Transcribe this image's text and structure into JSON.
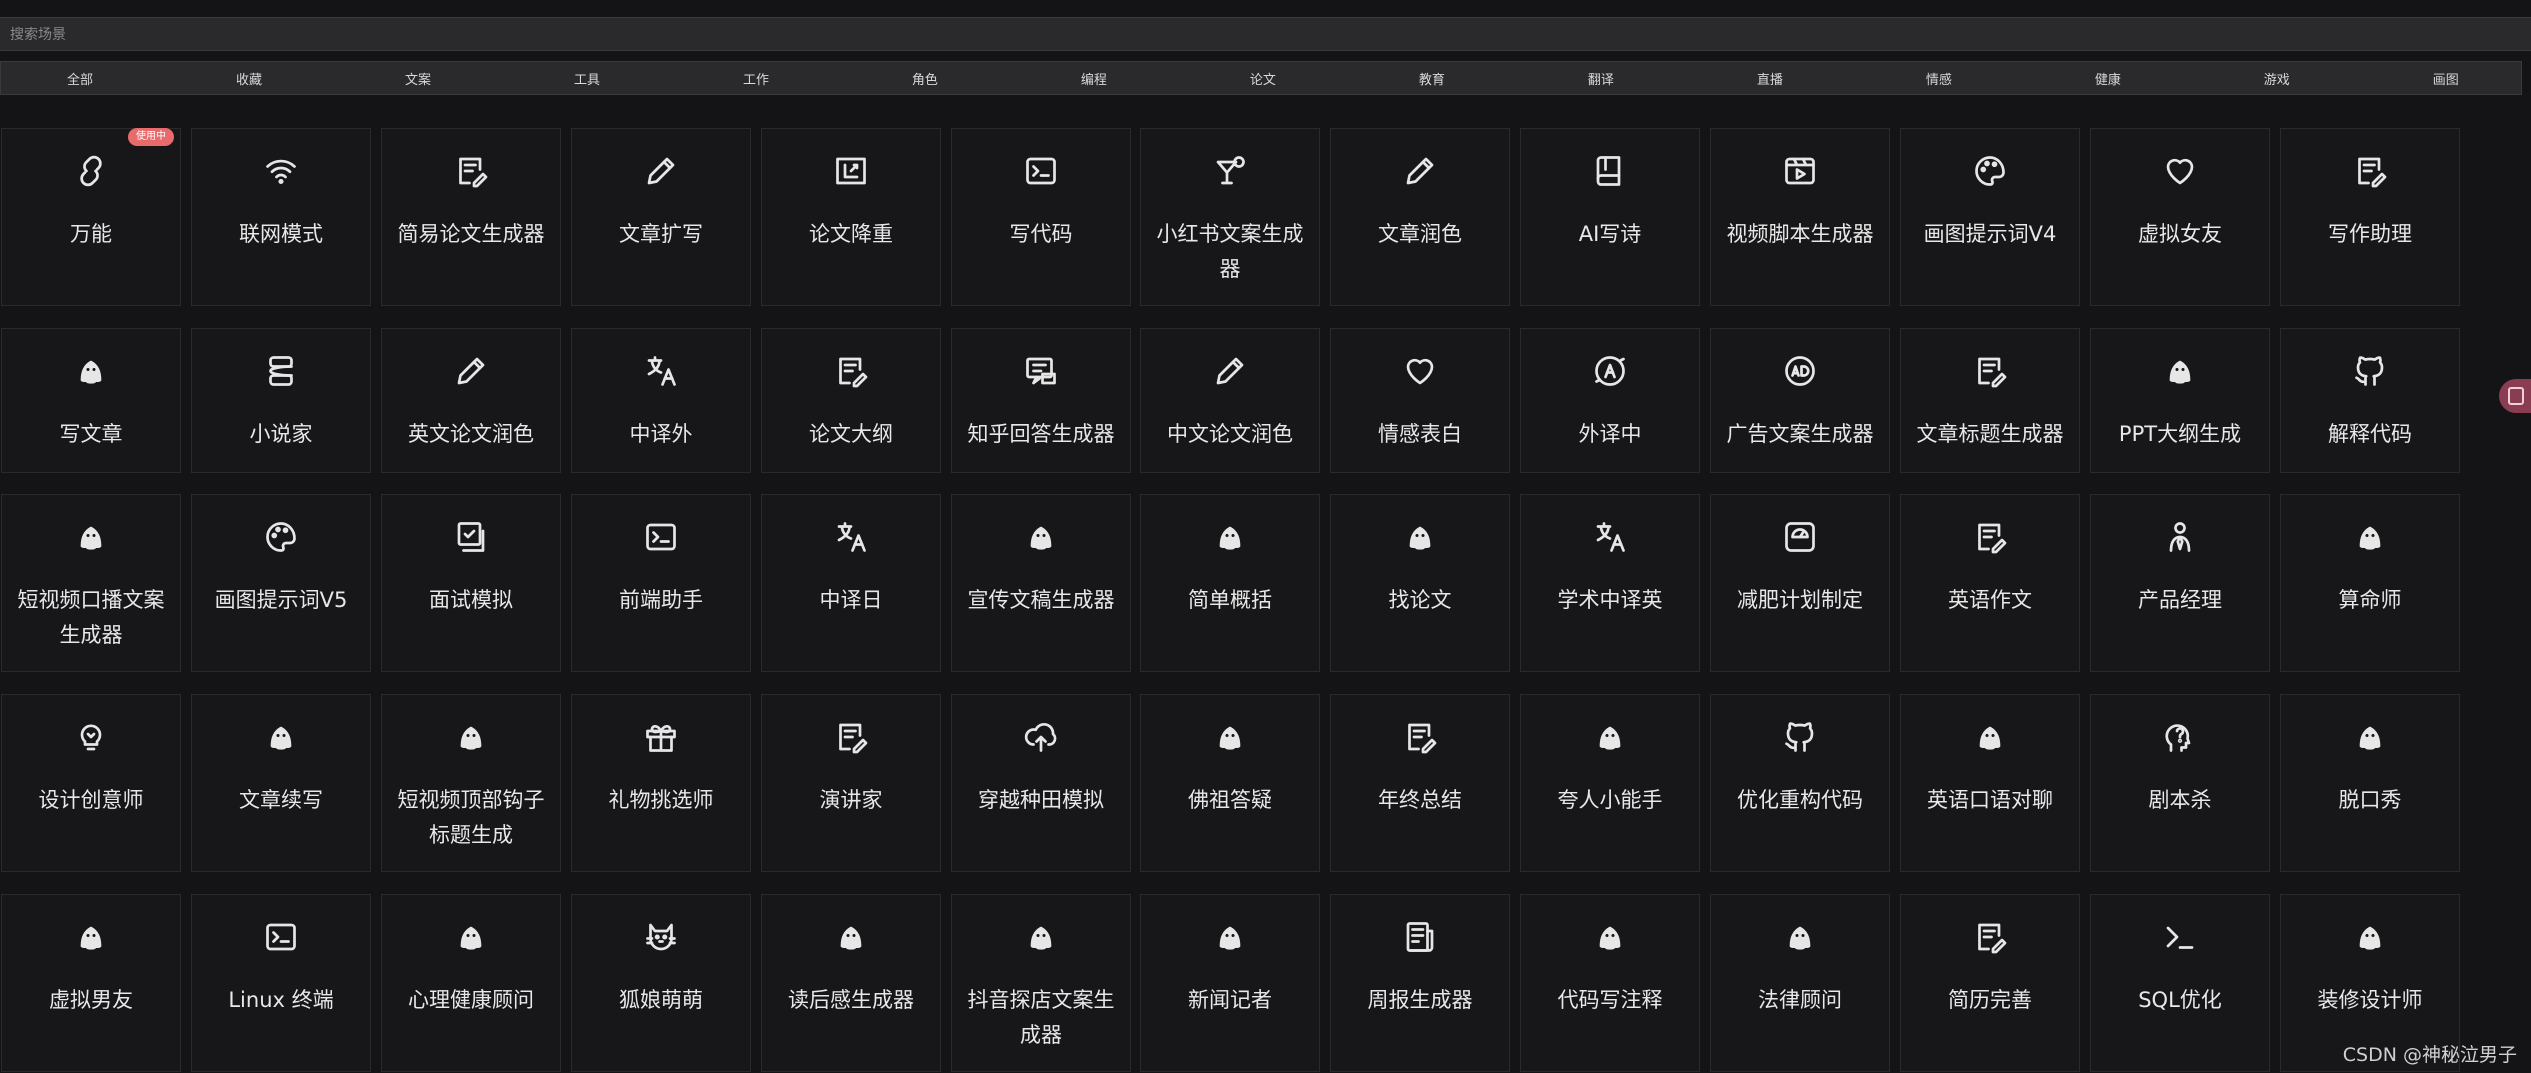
{
  "search": {
    "placeholder": "搜索场景"
  },
  "categories": [
    "全部",
    "收藏",
    "文案",
    "工具",
    "工作",
    "角色",
    "编程",
    "论文",
    "教育",
    "翻译",
    "直播",
    "情感",
    "健康",
    "游戏",
    "画图"
  ],
  "badge": "使用中",
  "cards": [
    {
      "label": "万能",
      "icon": "chain-link-icon"
    },
    {
      "label": "联网模式",
      "icon": "wifi-icon"
    },
    {
      "label": "简易论文生成器",
      "icon": "doc-edit-icon"
    },
    {
      "label": "文章扩写",
      "icon": "pencil-icon"
    },
    {
      "label": "论文降重",
      "icon": "image-frame-icon"
    },
    {
      "label": "写代码",
      "icon": "terminal-icon"
    },
    {
      "label": "小红书文案生成器",
      "icon": "cocktail-icon"
    },
    {
      "label": "文章润色",
      "icon": "pencil-icon"
    },
    {
      "label": "AI写诗",
      "icon": "book-icon"
    },
    {
      "label": "视频脚本生成器",
      "icon": "video-icon"
    },
    {
      "label": "画图提示词V4",
      "icon": "palette-icon"
    },
    {
      "label": "虚拟女友",
      "icon": "heart-icon"
    },
    {
      "label": "写作助理",
      "icon": "doc-edit-icon"
    },
    {
      "label": "写文章",
      "icon": "ghost-icon"
    },
    {
      "label": "小说家",
      "icon": "stack-icon"
    },
    {
      "label": "英文论文润色",
      "icon": "pencil-icon"
    },
    {
      "label": "中译外",
      "icon": "translate-icon"
    },
    {
      "label": "论文大纲",
      "icon": "doc-edit-icon"
    },
    {
      "label": "知乎回答生成器",
      "icon": "chat-icon"
    },
    {
      "label": "中文论文润色",
      "icon": "pencil-icon"
    },
    {
      "label": "情感表白",
      "icon": "heart-icon"
    },
    {
      "label": "外译中",
      "icon": "translate-circle-icon"
    },
    {
      "label": "广告文案生成器",
      "icon": "ad-icon"
    },
    {
      "label": "文章标题生成器",
      "icon": "doc-edit-icon"
    },
    {
      "label": "PPT大纲生成",
      "icon": "ghost-icon"
    },
    {
      "label": "解释代码",
      "icon": "github-icon"
    },
    {
      "label": "短视频口播文案生成器",
      "icon": "ghost-icon"
    },
    {
      "label": "画图提示词V5",
      "icon": "palette-icon"
    },
    {
      "label": "面试模拟",
      "icon": "checklist-icon"
    },
    {
      "label": "前端助手",
      "icon": "terminal-icon"
    },
    {
      "label": "中译日",
      "icon": "translate-icon"
    },
    {
      "label": "宣传文稿生成器",
      "icon": "ghost-icon"
    },
    {
      "label": "简单概括",
      "icon": "ghost-icon"
    },
    {
      "label": "找论文",
      "icon": "ghost-icon"
    },
    {
      "label": "学术中译英",
      "icon": "translate-icon"
    },
    {
      "label": "减肥计划制定",
      "icon": "scale-icon"
    },
    {
      "label": "英语作文",
      "icon": "doc-edit-icon"
    },
    {
      "label": "产品经理",
      "icon": "person-icon"
    },
    {
      "label": "算命师",
      "icon": "ghost-icon"
    },
    {
      "label": "设计创意师",
      "icon": "bulb-icon"
    },
    {
      "label": "文章续写",
      "icon": "ghost-icon"
    },
    {
      "label": "短视频顶部钩子标题生成",
      "icon": "ghost-icon"
    },
    {
      "label": "礼物挑选师",
      "icon": "gift-icon"
    },
    {
      "label": "演讲家",
      "icon": "doc-edit-icon"
    },
    {
      "label": "穿越种田模拟",
      "icon": "cloud-upload-icon"
    },
    {
      "label": "佛祖答疑",
      "icon": "ghost-icon"
    },
    {
      "label": "年终总结",
      "icon": "doc-edit-icon"
    },
    {
      "label": "夸人小能手",
      "icon": "ghost-icon"
    },
    {
      "label": "优化重构代码",
      "icon": "github-icon"
    },
    {
      "label": "英语口语对聊",
      "icon": "ghost-icon"
    },
    {
      "label": "剧本杀",
      "icon": "head-question-icon"
    },
    {
      "label": "脱口秀",
      "icon": "ghost-icon"
    },
    {
      "label": "虚拟男友",
      "icon": "ghost-icon"
    },
    {
      "label": "Linux 终端",
      "icon": "terminal-icon"
    },
    {
      "label": "心理健康顾问",
      "icon": "ghost-icon"
    },
    {
      "label": "狐娘萌萌",
      "icon": "cat-icon"
    },
    {
      "label": "读后感生成器",
      "icon": "ghost-icon"
    },
    {
      "label": "抖音探店文案生成器",
      "icon": "ghost-icon"
    },
    {
      "label": "新闻记者",
      "icon": "ghost-icon"
    },
    {
      "label": "周报生成器",
      "icon": "report-icon"
    },
    {
      "label": "代码写注释",
      "icon": "ghost-icon"
    },
    {
      "label": "法律顾问",
      "icon": "ghost-icon"
    },
    {
      "label": "简历完善",
      "icon": "doc-edit-icon"
    },
    {
      "label": "SQL优化",
      "icon": "prompt-icon"
    },
    {
      "label": "装修设计师",
      "icon": "ghost-icon"
    }
  ],
  "watermark": "CSDN @神秘泣男子"
}
